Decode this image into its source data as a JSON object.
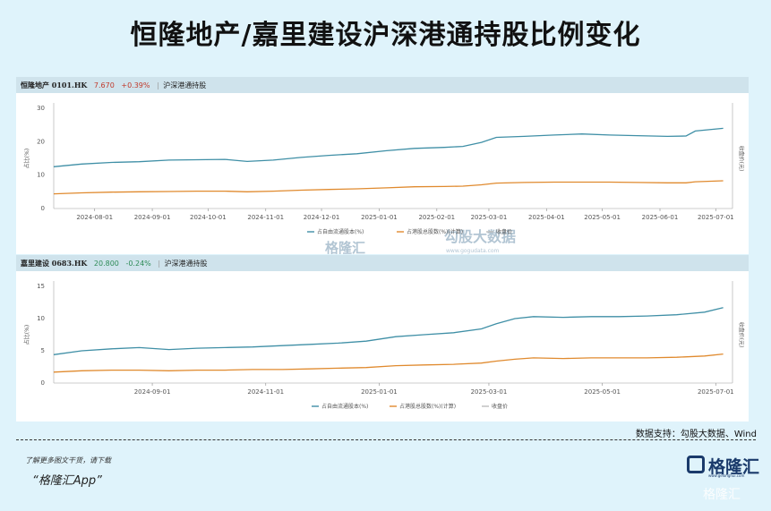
{
  "title": "恒隆地产/嘉里建设沪深港通持股比例变化",
  "source": "数据支持：勾股大数据、Wind",
  "footer": {
    "line1": "了解更多图文干货，请下载",
    "line2": "“格隆汇App”"
  },
  "logo": {
    "name": "格隆汇",
    "url": "www.gelonghui.com"
  },
  "watermark": "格隆汇",
  "chart_watermark": {
    "left": "格隆汇",
    "right": "勾股大数据",
    "left_url": "www.gelonghui.com",
    "right_url": "www.gogudata.com"
  },
  "colors": {
    "blue": "#3f8fa6",
    "orange": "#e08a2e",
    "grey": "#bbbbbb",
    "up": "#c0392b",
    "down": "#2e8b57"
  },
  "panels": [
    {
      "name": "恒隆地产 0101.HK",
      "price": "7.670",
      "change": "+0.39%",
      "tag": "沪深港通持股",
      "ylabel": "占比(%)",
      "y2label": "收盘价(元)"
    },
    {
      "name": "嘉里建设 0683.HK",
      "price": "20.800",
      "change": "-0.24%",
      "tag": "沪深港通持股",
      "ylabel": "占比(%)",
      "y2label": "收盘价(元)"
    }
  ],
  "chart_data": [
    {
      "type": "line",
      "ylim": [
        0,
        30
      ],
      "yticks": [
        "0",
        "10",
        "20",
        "30"
      ],
      "xticks": [
        "2024-08-01",
        "2024-09-01",
        "2024-10-01",
        "2024-11-01",
        "2024-12-01",
        "2025-01-01",
        "2025-02-01",
        "2025-03-01",
        "2025-04-01",
        "2025-05-01",
        "2025-06-01",
        "2025-07-01"
      ],
      "x": [
        "2024-07-10",
        "2024-07-25",
        "2024-08-10",
        "2024-08-25",
        "2024-09-10",
        "2024-09-25",
        "2024-10-10",
        "2024-10-22",
        "2024-11-05",
        "2024-11-20",
        "2024-12-05",
        "2024-12-20",
        "2025-01-05",
        "2025-01-20",
        "2025-02-05",
        "2025-02-15",
        "2025-02-25",
        "2025-03-05",
        "2025-03-20",
        "2025-04-05",
        "2025-04-20",
        "2025-05-05",
        "2025-05-20",
        "2025-06-05",
        "2025-06-15",
        "2025-06-20",
        "2025-07-05"
      ],
      "series": [
        {
          "name": "占自由流通股本(%)",
          "values": [
            12.5,
            13.3,
            13.8,
            14.0,
            14.5,
            14.6,
            14.7,
            14.1,
            14.5,
            15.3,
            15.9,
            16.4,
            17.3,
            18.0,
            18.3,
            18.6,
            19.8,
            21.3,
            21.6,
            22.0,
            22.3,
            22.0,
            21.8,
            21.6,
            21.7,
            23.2,
            24.0
          ]
        },
        {
          "name": "占港股总股数(%)(计算)",
          "values": [
            4.4,
            4.7,
            4.9,
            5.0,
            5.1,
            5.2,
            5.2,
            5.0,
            5.2,
            5.5,
            5.7,
            5.9,
            6.2,
            6.5,
            6.6,
            6.7,
            7.1,
            7.6,
            7.8,
            7.9,
            7.9,
            7.9,
            7.8,
            7.7,
            7.7,
            8.0,
            8.3
          ]
        }
      ],
      "legend": [
        "占自由流通股本(%)",
        "占港股总股数(%)(计算)",
        "收盘价"
      ]
    },
    {
      "type": "line",
      "ylim": [
        0,
        15
      ],
      "yticks": [
        "0",
        "5",
        "10",
        "15"
      ],
      "xticks": [
        "2024-09-01",
        "2024-11-01",
        "2025-01-01",
        "2025-03-01",
        "2025-05-01",
        "2025-07-01"
      ],
      "x": [
        "2024-07-10",
        "2024-07-25",
        "2024-08-10",
        "2024-08-25",
        "2024-09-10",
        "2024-09-25",
        "2024-10-10",
        "2024-10-25",
        "2024-11-10",
        "2024-11-25",
        "2024-12-10",
        "2024-12-25",
        "2025-01-10",
        "2025-01-25",
        "2025-02-10",
        "2025-02-25",
        "2025-03-05",
        "2025-03-15",
        "2025-03-25",
        "2025-04-10",
        "2025-04-25",
        "2025-05-10",
        "2025-05-25",
        "2025-06-10",
        "2025-06-25",
        "2025-07-05"
      ],
      "series": [
        {
          "name": "占自由流通股本(%)",
          "values": [
            4.4,
            5.0,
            5.3,
            5.5,
            5.2,
            5.4,
            5.5,
            5.6,
            5.8,
            6.0,
            6.2,
            6.5,
            7.2,
            7.5,
            7.8,
            8.4,
            9.2,
            10.0,
            10.3,
            10.2,
            10.3,
            10.3,
            10.4,
            10.6,
            11.0,
            11.7
          ]
        },
        {
          "name": "占港股总股数(%)(计算)",
          "values": [
            1.7,
            1.9,
            2.0,
            2.0,
            1.9,
            2.0,
            2.0,
            2.1,
            2.1,
            2.2,
            2.3,
            2.4,
            2.7,
            2.8,
            2.9,
            3.1,
            3.4,
            3.7,
            3.9,
            3.8,
            3.9,
            3.9,
            3.9,
            4.0,
            4.2,
            4.5
          ]
        }
      ],
      "legend": [
        "占自由流通股本(%)",
        "占港股总股数(%)(计算)",
        "收盘价"
      ]
    }
  ]
}
